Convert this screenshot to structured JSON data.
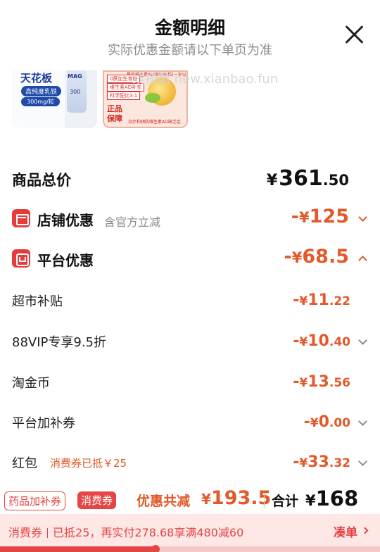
{
  "header": {
    "title": "金额明细",
    "subtitle": "实际优惠金额请以下单页为准"
  },
  "products": [
    {
      "name": "天花板",
      "tag1": "高纯度乳铁",
      "tag2": "300mg/粒",
      "bottle_brand": "MAG",
      "bottle_num": "300"
    },
    {
      "badge": "正品保障",
      "tag1": "0蔗加生育酚",
      "tag2": "维生素AD补充",
      "tag3": "科学配比3:1",
      "top_text": "星鲨维生素AD滴剂48粒(一岁以上)",
      "bottom_text": "治疗和预防维生素AD缺乏症"
    }
  ],
  "watermark": "线报酷 new.xianbao.fun",
  "total": {
    "label": "商品总价",
    "currency": "¥",
    "int": "361",
    "dec": ".50"
  },
  "store_discount": {
    "label": "店铺优惠",
    "note": "含官方立减",
    "sign": "-",
    "currency": "¥",
    "amount": "125"
  },
  "platform_discount": {
    "label": "平台优惠",
    "sign": "-",
    "currency": "¥",
    "amount": "68.5"
  },
  "items": [
    {
      "label": "超市补贴",
      "sign": "-",
      "currency": "¥",
      "int": "11",
      "dec": ".22",
      "note": ""
    },
    {
      "label": "88VIP专享9.5折",
      "sign": "-",
      "currency": "¥",
      "int": "10",
      "dec": ".40",
      "note": ""
    },
    {
      "label": "淘金币",
      "sign": "-",
      "currency": "¥",
      "int": "13",
      "dec": ".56",
      "note": ""
    },
    {
      "label": "平台加补券",
      "sign": "-",
      "currency": "¥",
      "int": "0",
      "dec": ".00",
      "note": ""
    },
    {
      "label": "红包",
      "sign": "-",
      "currency": "¥",
      "int": "33",
      "dec": ".32",
      "note": "消费券已抵￥25"
    }
  ],
  "bottom_bar": {
    "chip1": "药品加补券",
    "chip2": "消费券",
    "save_label": "优惠共减",
    "save_currency": "¥",
    "save_amount": "193.5",
    "sum_label": "合计",
    "sum_currency": "¥",
    "sum_amount": "168"
  },
  "coupon_bar": {
    "tag": "消费券",
    "text": "已抵25，再实付278.68享满480减60",
    "action": "凑单"
  },
  "progress": {
    "value": 0.41
  },
  "colors": {
    "accent": "#e2592a",
    "red": "#e64545",
    "coupon_bg": "#fde8e6"
  }
}
